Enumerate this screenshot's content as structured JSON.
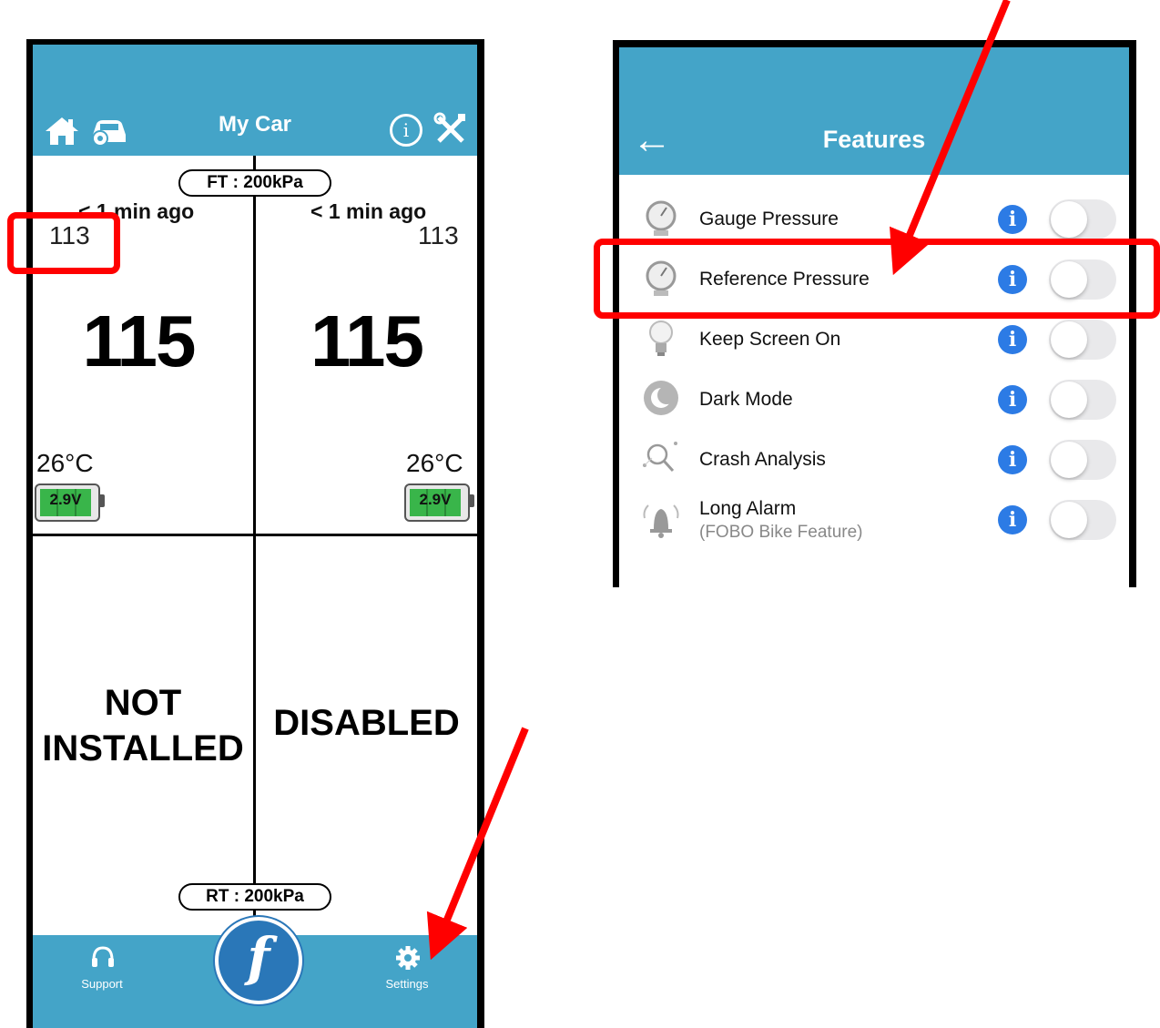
{
  "left_screen": {
    "title": "My Car",
    "front_pill": "FT : 200kPa",
    "rear_pill": "RT : 200kPa",
    "tires": {
      "front_left": {
        "updated": "< 1 min ago",
        "reference": "113",
        "pressure": "115",
        "temperature": "26°C",
        "battery": "2.9V"
      },
      "front_right": {
        "updated": "< 1 min ago",
        "reference": "113",
        "pressure": "115",
        "temperature": "26°C",
        "battery": "2.9V"
      },
      "rear_left": {
        "state_line1": "NOT",
        "state_line2": "INSTALLED"
      },
      "rear_right": {
        "state": "DISABLED"
      }
    },
    "footer": {
      "support_label": "Support",
      "settings_label": "Settings",
      "logo_letter": "f"
    }
  },
  "right_screen": {
    "title": "Features",
    "back_arrow": "←",
    "features": [
      {
        "label": "Gauge Pressure",
        "icon": "gauge-icon",
        "enabled": false
      },
      {
        "label": "Reference Pressure",
        "icon": "gauge-icon",
        "enabled": false
      },
      {
        "label": "Keep Screen On",
        "icon": "lightbulb-icon",
        "enabled": false
      },
      {
        "label": "Dark Mode",
        "icon": "moon-icon",
        "enabled": false
      },
      {
        "label": "Crash Analysis",
        "icon": "magnifier-icon",
        "enabled": false
      },
      {
        "label": "Long Alarm",
        "sublabel": "(FOBO Bike Feature)",
        "icon": "bell-alarm-icon",
        "enabled": false
      }
    ],
    "info_glyph": "i"
  },
  "colors": {
    "header_blue": "#44a4c8",
    "annotation_red": "#ff0000",
    "info_blue": "#2c7be5",
    "battery_green": "#39b54a"
  }
}
